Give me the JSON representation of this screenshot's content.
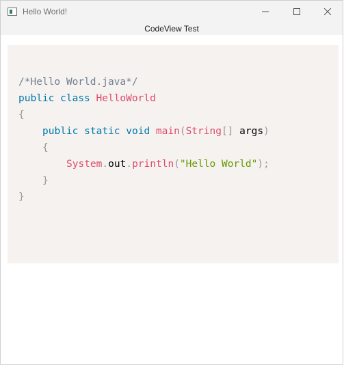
{
  "window": {
    "title": "Hello World!",
    "icon": "app-window-icon"
  },
  "header": {
    "label": "CodeView Test"
  },
  "code": {
    "language": "java",
    "lines": [
      [
        {
          "t": "comment",
          "v": "/*Hello World.java*/"
        }
      ],
      [
        {
          "t": "keyword",
          "v": "public"
        },
        {
          "t": "plain",
          "v": " "
        },
        {
          "t": "keyword",
          "v": "class"
        },
        {
          "t": "plain",
          "v": " "
        },
        {
          "t": "classname",
          "v": "HelloWorld"
        }
      ],
      [
        {
          "t": "punct",
          "v": "{"
        }
      ],
      [
        {
          "t": "keyword",
          "v": "public"
        },
        {
          "t": "plain",
          "v": " "
        },
        {
          "t": "keyword",
          "v": "static"
        },
        {
          "t": "plain",
          "v": " "
        },
        {
          "t": "keyword",
          "v": "void"
        },
        {
          "t": "plain",
          "v": " "
        },
        {
          "t": "classname",
          "v": "main"
        },
        {
          "t": "punct",
          "v": "("
        },
        {
          "t": "classname",
          "v": "String"
        },
        {
          "t": "punct",
          "v": "[]"
        },
        {
          "t": "plain",
          "v": " args"
        },
        {
          "t": "punct",
          "v": ")"
        }
      ],
      [
        {
          "t": "punct",
          "v": "{"
        }
      ],
      [
        {
          "t": "classname",
          "v": "System"
        },
        {
          "t": "punct",
          "v": "."
        },
        {
          "t": "plain",
          "v": "out"
        },
        {
          "t": "punct",
          "v": "."
        },
        {
          "t": "classname",
          "v": "println"
        },
        {
          "t": "punct",
          "v": "("
        },
        {
          "t": "string",
          "v": "\"Hello World\""
        },
        {
          "t": "punct",
          "v": ");"
        }
      ],
      [
        {
          "t": "punct",
          "v": "}"
        }
      ],
      [
        {
          "t": "punct",
          "v": "}"
        }
      ]
    ]
  },
  "colors": {
    "code_background": "#f5f2f0",
    "comment": "#708090",
    "keyword": "#0077aa",
    "classname": "#dd4a68",
    "punct": "#999999",
    "string": "#669900"
  }
}
